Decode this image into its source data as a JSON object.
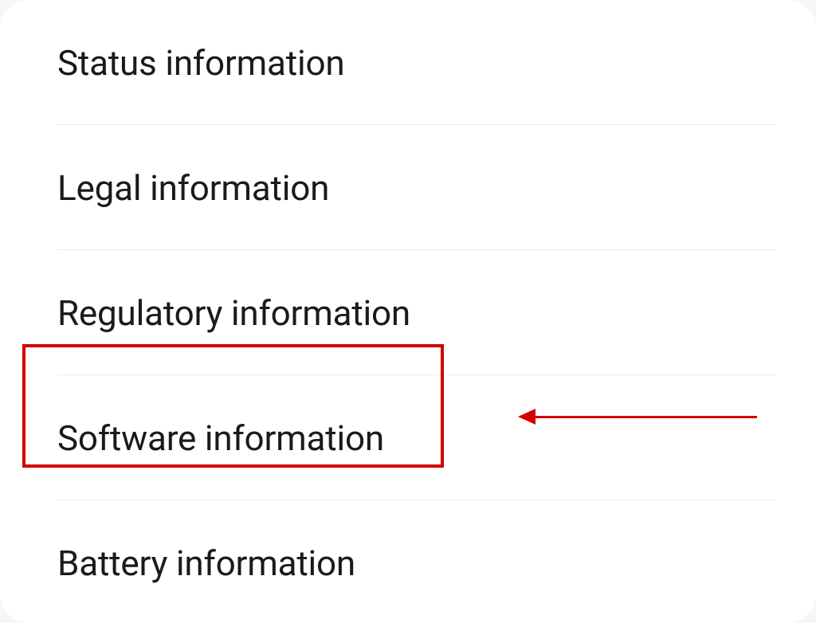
{
  "settings": {
    "items": [
      {
        "label": "Status information"
      },
      {
        "label": "Legal information"
      },
      {
        "label": "Regulatory information"
      },
      {
        "label": "Software information"
      },
      {
        "label": "Battery information"
      }
    ]
  },
  "annotation": {
    "highlight_color": "#d30000"
  }
}
